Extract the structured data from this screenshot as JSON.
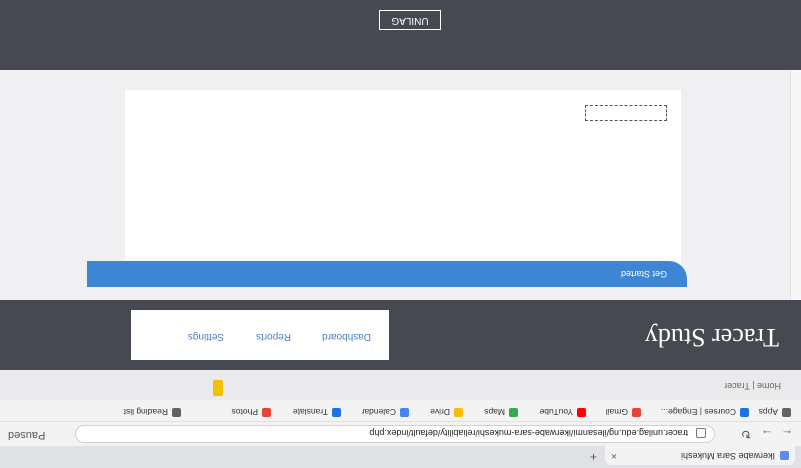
{
  "browser": {
    "tab_title": "Ikerwabe Sara Mukeshi",
    "new_tab": "+",
    "url": "tracer.unilag.edu.ng/ilesanmi/ikerwabe-sara-mukeshi/reliability/default/index.php",
    "nav_back": "←",
    "nav_forward": "→",
    "nav_reload": "↻",
    "profile_btn": "Paused",
    "bookmarks": [
      {
        "label": "Apps",
        "color": "#5f6368"
      },
      {
        "label": "Courses | Engage...",
        "color": "#1a73e8"
      },
      {
        "label": "Gmail",
        "color": "#ea4335"
      },
      {
        "label": "YouTube",
        "color": "#ff0000"
      },
      {
        "label": "Maps",
        "color": "#34a853"
      },
      {
        "label": "Drive",
        "color": "#fbbc04"
      },
      {
        "label": "Calendar",
        "color": "#4285f4"
      },
      {
        "label": "Translate",
        "color": "#1a73e8"
      },
      {
        "label": "Photos",
        "color": "#ea4335"
      },
      {
        "label": "Reading list",
        "color": "#5f6368"
      }
    ]
  },
  "site": {
    "user_label": "",
    "user_name": "",
    "home": "Home | Tracer",
    "hero_title": "Tracer Study",
    "menu": [
      "Dashboard",
      "Reports",
      "Settings"
    ],
    "card": {
      "button_label": "Get Started",
      "lines": [
        "",
        "",
        "",
        "",
        "",
        ""
      ],
      "submit_label": ""
    },
    "footer_note": "",
    "logo_text": "UNILAG"
  }
}
